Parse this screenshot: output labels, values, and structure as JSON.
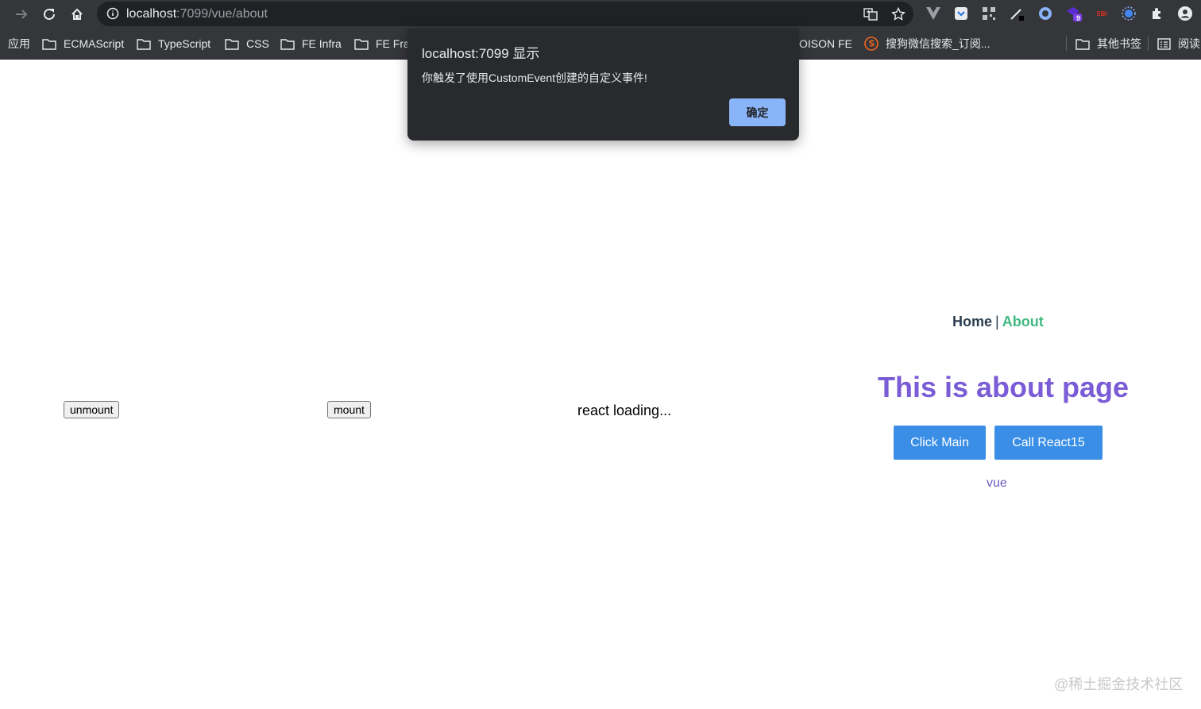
{
  "browser": {
    "url_host": "localhost",
    "url_rest": ":7099/vue/about",
    "bookmarks": [
      {
        "label": "应用",
        "folder": false
      },
      {
        "label": "ECMAScript",
        "folder": true
      },
      {
        "label": "TypeScript",
        "folder": true
      },
      {
        "label": "CSS",
        "folder": true
      },
      {
        "label": "FE Infra",
        "folder": true
      },
      {
        "label": "FE Fra",
        "folder": true
      },
      {
        "label": "OISON FE",
        "folder": false
      },
      {
        "label": "搜狗微信搜索_订阅...",
        "folder": false
      },
      {
        "label": "其他书签",
        "folder": true
      },
      {
        "label": "阅读",
        "folder": false
      }
    ],
    "extension_badge": "9",
    "extension_red_text": "SBI"
  },
  "dialog": {
    "title": "localhost:7099 显示",
    "message": "你触发了使用CustomEvent创建的自定义事件!",
    "ok_label": "确定"
  },
  "page": {
    "unmount_label": "unmount",
    "mount_label": "mount",
    "react_loading": "react loading...",
    "nav": {
      "home": "Home",
      "separator": "|",
      "about": "About"
    },
    "title": "This is about page",
    "click_main_label": "Click Main",
    "call_react_label": "Call React15",
    "vue_label": "vue"
  },
  "watermark": "@稀土掘金技术社区",
  "colors": {
    "chrome_bg": "#35363a",
    "dialog_bg": "#292a2d",
    "dialog_button": "#8ab4f8",
    "vue_green": "#42b983",
    "title_purple": "#7a5cd6",
    "primary_blue": "#3a8ee6"
  }
}
